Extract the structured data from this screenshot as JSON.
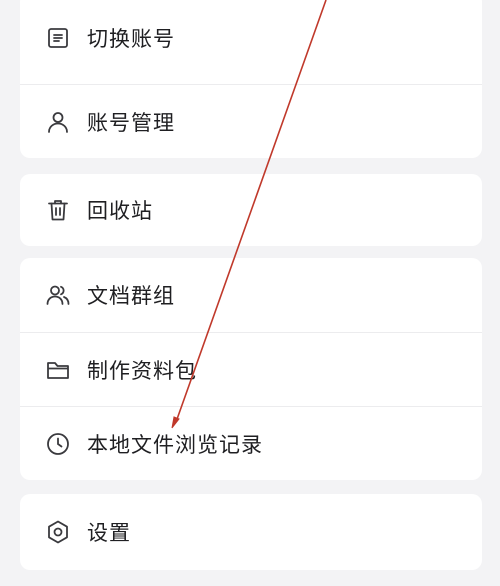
{
  "menu": {
    "group1": [
      {
        "label": "切换账号",
        "icon": "switch-account-icon"
      },
      {
        "label": "账号管理",
        "icon": "user-icon"
      }
    ],
    "group2": [
      {
        "label": "回收站",
        "icon": "trash-icon"
      }
    ],
    "group3": [
      {
        "label": "文档群组",
        "icon": "group-icon"
      },
      {
        "label": "制作资料包",
        "icon": "folder-icon"
      },
      {
        "label": "本地文件浏览记录",
        "icon": "clock-icon"
      }
    ],
    "group4": [
      {
        "label": "设置",
        "icon": "settings-icon"
      }
    ]
  },
  "colors": {
    "background": "#f3f3f5",
    "card": "#ffffff",
    "text": "#1f1f22",
    "icon": "#3a3a3e",
    "annotation_arrow": "#c0392b"
  }
}
